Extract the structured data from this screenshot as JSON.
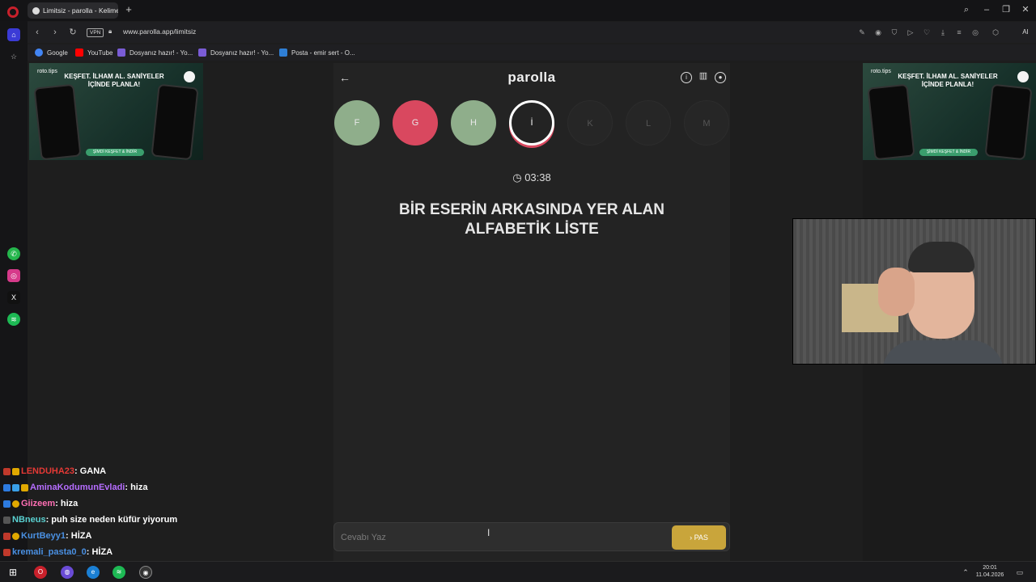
{
  "browser": {
    "tab_title": "Limitsiz - parolla - Kelime",
    "new_tab": "+",
    "url": "www.parolla.app/limitsiz",
    "vpn": "VPN",
    "ai_label": "AI",
    "bookmarks": [
      {
        "label": "Google",
        "icon": "google-icon",
        "color": "#4285f4"
      },
      {
        "label": "YouTube",
        "icon": "youtube-icon",
        "color": "#ff0000"
      },
      {
        "label": "Dosyanız hazır! - Yo...",
        "icon": "bookmark-icon",
        "color": "#7a5cd6"
      },
      {
        "label": "Dosyanız hazır! - Yo...",
        "icon": "bookmark-icon",
        "color": "#7a5cd6"
      },
      {
        "label": "Posta - emir sert - O...",
        "icon": "mail-icon",
        "color": "#2f7fd6"
      }
    ]
  },
  "ad": {
    "brand": "roto.tips",
    "headline": "KEŞFET. İLHAM AL. SANİYELER İÇİNDE PLANLA!",
    "cta": "ŞİMDİ KEŞFET & İNDİR"
  },
  "game": {
    "logo": "parolla",
    "letters": [
      {
        "letter": "F",
        "state": "correct",
        "color": "#8fae8b"
      },
      {
        "letter": "G",
        "state": "wrong",
        "color": "#d9485f"
      },
      {
        "letter": "H",
        "state": "correct",
        "color": "#8fae8b"
      },
      {
        "letter": "İ",
        "state": "active",
        "color": "#232323"
      },
      {
        "letter": "K",
        "state": "pending",
        "color": "#262626"
      },
      {
        "letter": "L",
        "state": "pending",
        "color": "#262626"
      },
      {
        "letter": "M",
        "state": "pending",
        "color": "#262626"
      }
    ],
    "timer": "03:38",
    "question_line1": "BİR ESERİN ARKASINDA YER ALAN",
    "question_line2": "ALFABETİK LİSTE",
    "answer_placeholder": "Cevabı Yaz",
    "pass_label": "PAS",
    "accent": "#c9a53b"
  },
  "chat": [
    {
      "user": "LENDUHA23",
      "color": "#e53935",
      "message": ": GANA"
    },
    {
      "user": "AminaKodumunEvladi",
      "color": "#b66dff",
      "message": ": hiza"
    },
    {
      "user": "Giizeem",
      "color": "#ff6fb4",
      "message": ": hiza"
    },
    {
      "user": "NBneus",
      "color": "#5ad1d1",
      "message": ": puh size neden küfür yiyorum"
    },
    {
      "user": "KurtBeyy1",
      "color": "#4a90e2",
      "message": ": HİZA"
    },
    {
      "user": "kremali_pasta0_0",
      "color": "#4a90e2",
      "message": ": HİZA"
    }
  ],
  "taskbar": {
    "time": "20:01",
    "date": "11.04.2026"
  }
}
